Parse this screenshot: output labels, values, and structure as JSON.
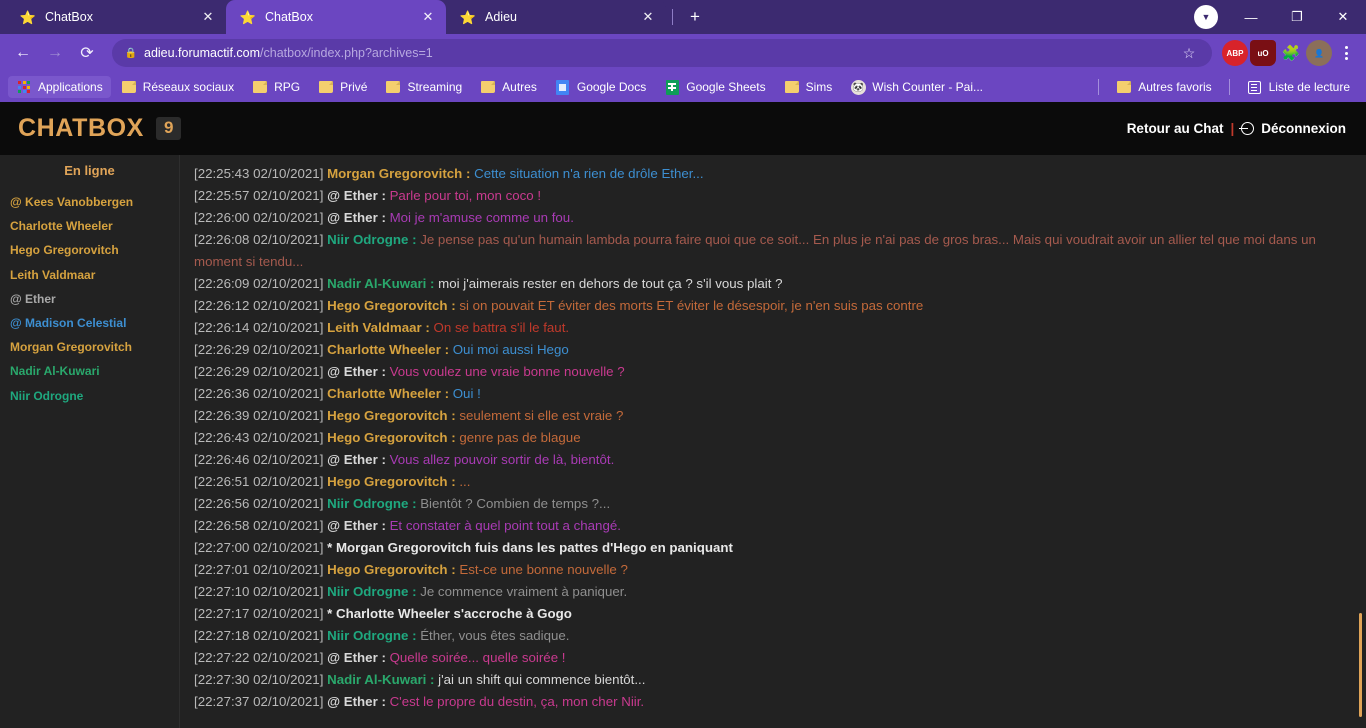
{
  "browser": {
    "tabs": [
      {
        "title": "ChatBox",
        "favicon": "star-icon",
        "active": false
      },
      {
        "title": "ChatBox",
        "favicon": "star-icon",
        "active": true
      },
      {
        "title": "Adieu",
        "favicon": "star-icon",
        "active": false
      }
    ],
    "new_tab_label": "+",
    "close_label": "✕",
    "window_controls": {
      "minimize": "—",
      "maximize": "❐",
      "close": "✕",
      "profile_badge": "▼"
    },
    "nav": {
      "back": "←",
      "forward": "→",
      "reload": "⟳"
    },
    "omnibox": {
      "lock_icon": "lock-icon",
      "host": "adieu.forumactif.com",
      "path": "/chatbox/index.php?archives=1",
      "full_url": "adieu.forumactif.com/chatbox/index.php?archives=1",
      "star_icon": "☆"
    },
    "extensions": [
      {
        "name": "adblock-plus",
        "label": "ABP",
        "color": "#d8232a"
      },
      {
        "name": "ublock-origin",
        "label": "uO",
        "color": "#7a0f14"
      },
      {
        "name": "extensions-puzzle",
        "label": "🧩",
        "color": "#ffffff"
      }
    ],
    "bookmarks": [
      {
        "label": "Applications",
        "icon": "apps-grid-icon"
      },
      {
        "label": "Réseaux sociaux",
        "icon": "folder-icon"
      },
      {
        "label": "RPG",
        "icon": "folder-icon"
      },
      {
        "label": "Privé",
        "icon": "folder-icon"
      },
      {
        "label": "Streaming",
        "icon": "folder-icon"
      },
      {
        "label": "Autres",
        "icon": "folder-icon"
      },
      {
        "label": "Google Docs",
        "icon": "google-docs-icon"
      },
      {
        "label": "Google Sheets",
        "icon": "google-sheets-icon"
      },
      {
        "label": "Sims",
        "icon": "folder-icon"
      },
      {
        "label": "Wish Counter - Pai...",
        "icon": "panda-icon"
      }
    ],
    "bookmarks_right": [
      {
        "label": "Autres favoris",
        "icon": "folder-icon"
      },
      {
        "label": "Liste de lecture",
        "icon": "reading-list-icon"
      }
    ]
  },
  "chatbox": {
    "title": "CHATBOX",
    "badge": "9",
    "back_to_chat": "Retour au Chat",
    "separator": "|",
    "logout": "Déconnexion",
    "sidebar": {
      "title": "En ligne",
      "users": [
        {
          "name": "@ Kees Vanobbergen",
          "color": "#d6a23f"
        },
        {
          "name": "Charlotte Wheeler",
          "color": "#d6a23f"
        },
        {
          "name": "Hego Gregorovitch",
          "color": "#d6a23f"
        },
        {
          "name": "Leith Valdmaar",
          "color": "#d6a23f"
        },
        {
          "name": "@ Ether",
          "color": "#a8a8a8"
        },
        {
          "name": "@ Madison Celestial",
          "color": "#3d8fd1"
        },
        {
          "name": "Morgan Gregorovitch",
          "color": "#d6a23f"
        },
        {
          "name": "Nadir Al-Kuwari",
          "color": "#2aa86c"
        },
        {
          "name": "Niir Odrogne",
          "color": "#1fa87f"
        }
      ]
    },
    "messages": [
      {
        "time": "[22:25:43 02/10/2021]",
        "nick": "Morgan Gregorovitch",
        "nick_color": "#d6a23f",
        "text": "Cette situation n'a rien de drôle Ether...",
        "text_color": "#3d8fd1",
        "action": false
      },
      {
        "time": "[22:25:57 02/10/2021]",
        "nick": "@ Ether",
        "nick_color": "#d8d8d8",
        "text": "Parle pour toi, mon coco !",
        "text_color": "#c93a8f",
        "action": false
      },
      {
        "time": "[22:26:00 02/10/2021]",
        "nick": "@ Ether",
        "nick_color": "#d8d8d8",
        "text": "Moi je m'amuse comme un fou.",
        "text_color": "#a93bb5",
        "action": false
      },
      {
        "time": "[22:26:08 02/10/2021]",
        "nick": "Niir Odrogne",
        "nick_color": "#1fa87f",
        "text": "Je pense pas qu'un humain lambda pourra faire quoi que ce soit... En plus je n'ai pas de gros bras... Mais qui voudrait avoir un allier tel que moi dans un moment si tendu...",
        "text_color": "#a55a4e",
        "action": false
      },
      {
        "time": "[22:26:09 02/10/2021]",
        "nick": "Nadir Al-Kuwari",
        "nick_color": "#2aa86c",
        "text": "moi j'aimerais rester en dehors de tout ça ? s'il vous plait ?",
        "text_color": "#d8d8d8",
        "action": false
      },
      {
        "time": "[22:26:12 02/10/2021]",
        "nick": "Hego Gregorovitch",
        "nick_color": "#d6a23f",
        "text": "si on pouvait ET éviter des morts ET éviter le désespoir, je n'en suis pas contre",
        "text_color": "#c46a3a",
        "action": false
      },
      {
        "time": "[22:26:14 02/10/2021]",
        "nick": "Leith Valdmaar",
        "nick_color": "#d6a23f",
        "text": "On se battra s'il le faut.",
        "text_color": "#c0392b",
        "action": false
      },
      {
        "time": "[22:26:29 02/10/2021]",
        "nick": "Charlotte Wheeler",
        "nick_color": "#d6a23f",
        "text": "Oui moi aussi Hego",
        "text_color": "#3d8fd1",
        "action": false
      },
      {
        "time": "[22:26:29 02/10/2021]",
        "nick": "@ Ether",
        "nick_color": "#d8d8d8",
        "text": "Vous voulez une vraie bonne nouvelle ?",
        "text_color": "#c93a8f",
        "action": false
      },
      {
        "time": "[22:26:36 02/10/2021]",
        "nick": "Charlotte Wheeler",
        "nick_color": "#d6a23f",
        "text": "Oui !",
        "text_color": "#3d8fd1",
        "action": false
      },
      {
        "time": "[22:26:39 02/10/2021]",
        "nick": "Hego Gregorovitch",
        "nick_color": "#d6a23f",
        "text": "seulement si elle est vraie ?",
        "text_color": "#c46a3a",
        "action": false
      },
      {
        "time": "[22:26:43 02/10/2021]",
        "nick": "Hego Gregorovitch",
        "nick_color": "#d6a23f",
        "text": "genre pas de blague",
        "text_color": "#c46a3a",
        "action": false
      },
      {
        "time": "[22:26:46 02/10/2021]",
        "nick": "@ Ether",
        "nick_color": "#d8d8d8",
        "text": "Vous allez pouvoir sortir de là, bientôt.",
        "text_color": "#a93bb5",
        "action": false
      },
      {
        "time": "[22:26:51 02/10/2021]",
        "nick": "Hego Gregorovitch",
        "nick_color": "#d6a23f",
        "text": "...",
        "text_color": "#c46a3a",
        "action": false
      },
      {
        "time": "[22:26:56 02/10/2021]",
        "nick": "Niir Odrogne",
        "nick_color": "#1fa87f",
        "text": "Bientôt ? Combien de temps ?...",
        "text_color": "#8f8f8f",
        "action": false
      },
      {
        "time": "[22:26:58 02/10/2021]",
        "nick": "@ Ether",
        "nick_color": "#d8d8d8",
        "text": "Et constater à quel point tout a changé.",
        "text_color": "#a93bb5",
        "action": false
      },
      {
        "time": "[22:27:00 02/10/2021]",
        "nick": "",
        "nick_color": "",
        "text": "* Morgan Gregorovitch fuis dans les pattes d'Hego en paniquant",
        "text_color": "#e8e8e8",
        "action": true
      },
      {
        "time": "[22:27:01 02/10/2021]",
        "nick": "Hego Gregorovitch",
        "nick_color": "#d6a23f",
        "text": "Est-ce une bonne nouvelle ?",
        "text_color": "#c46a3a",
        "action": false
      },
      {
        "time": "[22:27:10 02/10/2021]",
        "nick": "Niir Odrogne",
        "nick_color": "#1fa87f",
        "text": "Je commence vraiment à paniquer.",
        "text_color": "#8f8f8f",
        "action": false
      },
      {
        "time": "[22:27:17 02/10/2021]",
        "nick": "",
        "nick_color": "",
        "text": "* Charlotte Wheeler s'accroche à Gogo",
        "text_color": "#e8e8e8",
        "action": true
      },
      {
        "time": "[22:27:18 02/10/2021]",
        "nick": "Niir Odrogne",
        "nick_color": "#1fa87f",
        "text": "Éther, vous êtes sadique.",
        "text_color": "#8f8f8f",
        "action": false
      },
      {
        "time": "[22:27:22 02/10/2021]",
        "nick": "@ Ether",
        "nick_color": "#d8d8d8",
        "text": "Quelle soirée... quelle soirée !",
        "text_color": "#c93a8f",
        "action": false
      },
      {
        "time": "[22:27:30 02/10/2021]",
        "nick": "Nadir Al-Kuwari",
        "nick_color": "#2aa86c",
        "text": "j'ai un shift qui commence bientôt...",
        "text_color": "#d8d8d8",
        "action": false
      },
      {
        "time": "[22:27:37 02/10/2021]",
        "nick": "@ Ether",
        "nick_color": "#d8d8d8",
        "text": "C'est le propre du destin, ça, mon cher Niir.",
        "text_color": "#c93a8f",
        "action": false
      }
    ],
    "scrollbar": {
      "thumb_top_pct": 80,
      "thumb_height_pct": 18,
      "color": "#e0a458"
    }
  }
}
